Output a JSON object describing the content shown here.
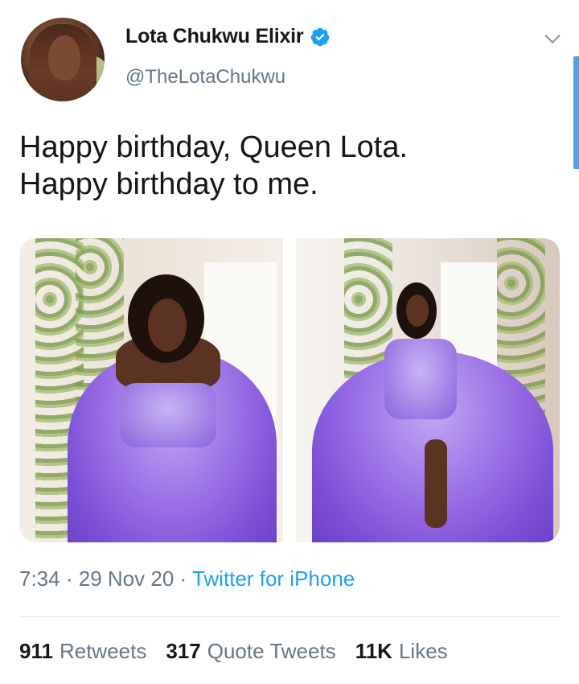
{
  "author": {
    "display_name": "Lota Chukwu Elixir",
    "handle": "@TheLotaChukwu",
    "verified": true,
    "avatar_icon": "profile-photo"
  },
  "tweet": {
    "lines": [
      "Happy birthday, Queen Lota.",
      "Happy birthday to me."
    ],
    "media_count": 2
  },
  "meta": {
    "time": "7:34",
    "separator": "·",
    "date": "29 Nov 20",
    "source": "Twitter for iPhone"
  },
  "stats": {
    "retweets_count": "911",
    "retweets_label": "Retweets",
    "quotes_count": "317",
    "quotes_label": "Quote Tweets",
    "likes_count": "11K",
    "likes_label": "Likes"
  },
  "colors": {
    "accent": "#1da1f2",
    "secondary_text": "#657786",
    "primary_text": "#14171a"
  }
}
